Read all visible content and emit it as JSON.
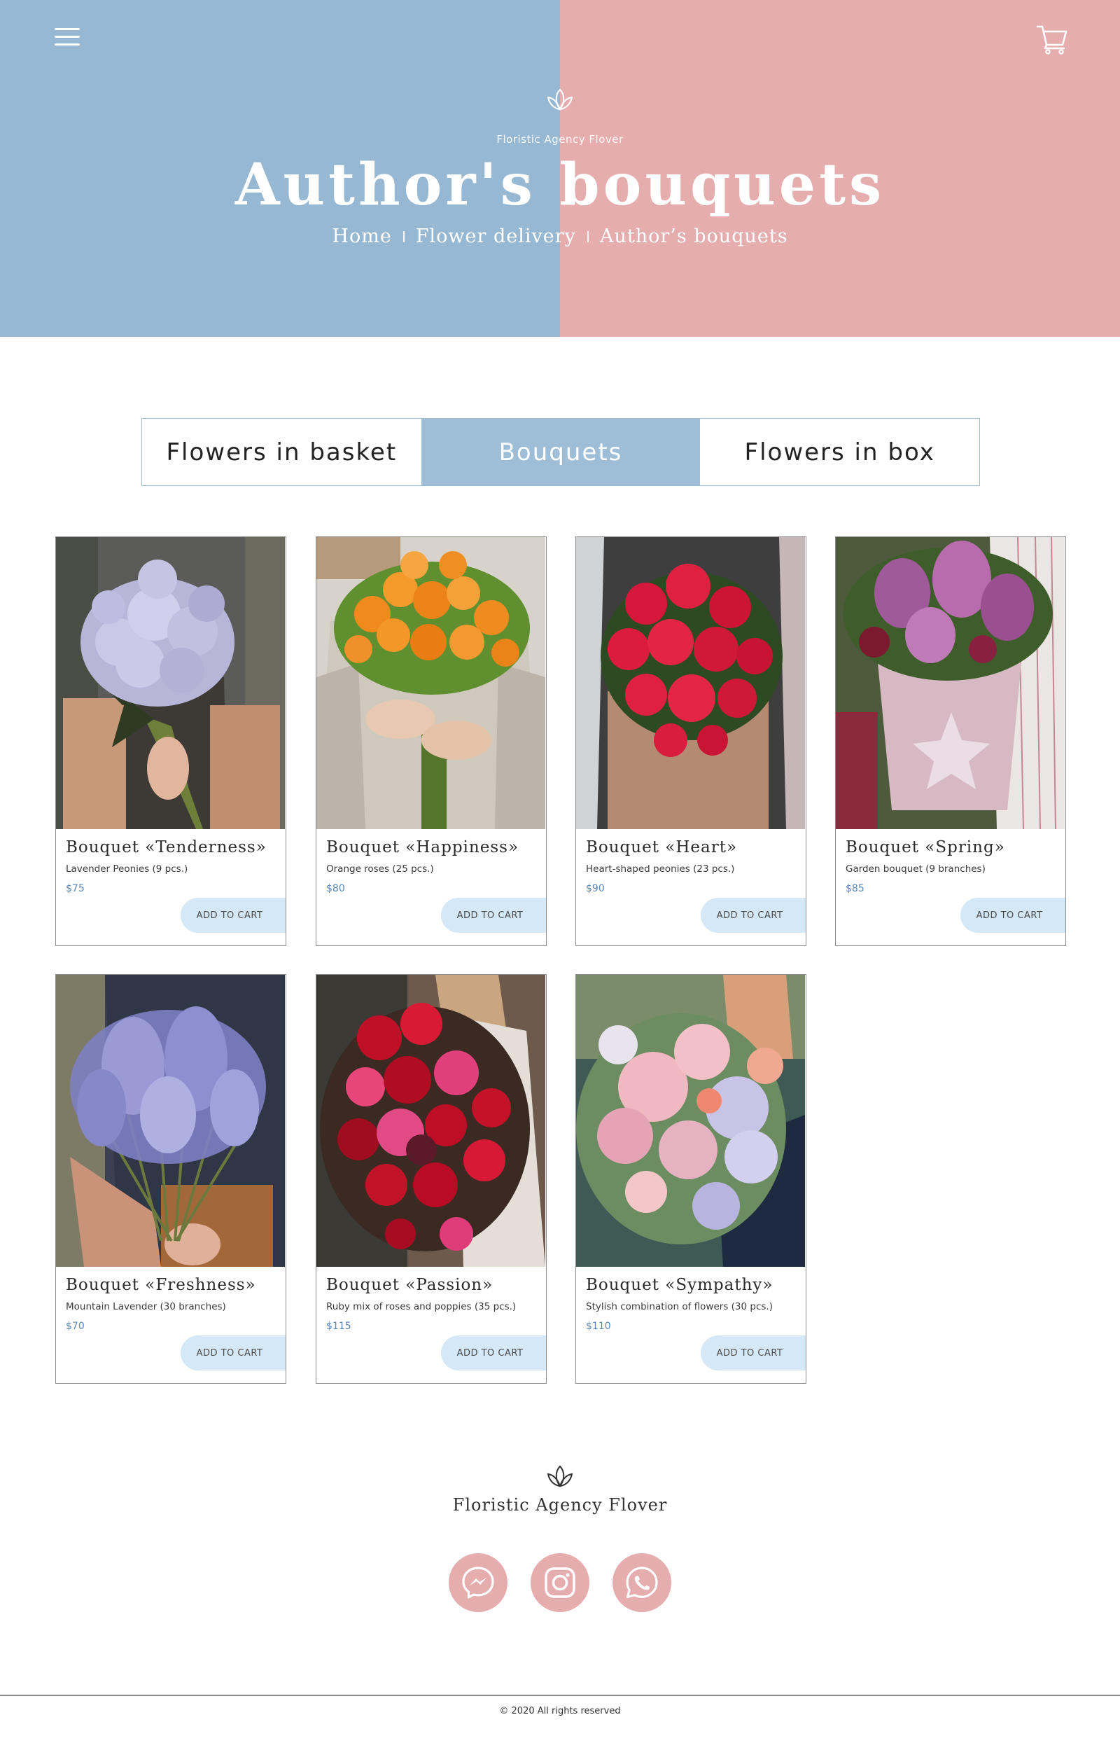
{
  "colors": {
    "hero_left": "#97b8d3",
    "hero_right": "#e6adae",
    "tab_active": "#9ebdd7",
    "button_bg": "#d5e8f7",
    "social_bg": "#e6adae",
    "price": "#5a86b4"
  },
  "header": {
    "menu_icon": "hamburger-menu-icon",
    "cart_icon": "shopping-cart-icon",
    "logo_icon": "lotus-icon",
    "tagline": "Floristic Agency Flover",
    "title": "Author's bouquets",
    "breadcrumb": [
      "Home",
      "Flower delivery",
      "Author’s bouquets"
    ]
  },
  "tabs": [
    {
      "label": "Flowers in basket",
      "active": false
    },
    {
      "label": "Bouquets",
      "active": true
    },
    {
      "label": "Flowers in box",
      "active": false
    }
  ],
  "products": [
    {
      "name": "Bouquet «Tenderness»",
      "desc": "Lavender Peonies (9 pcs.)",
      "price": "$75",
      "button": "ADD TO CART",
      "image": "lavender-peonies-bouquet"
    },
    {
      "name": "Bouquet «Happiness»",
      "desc": "Orange roses (25 pcs.)",
      "price": "$80",
      "button": "ADD TO CART",
      "image": "orange-roses-bouquet"
    },
    {
      "name": "Bouquet «Heart»",
      "desc": "Heart-shaped peonies (23 pcs.)",
      "price": "$90",
      "button": "ADD TO CART",
      "image": "red-peonies-bouquet"
    },
    {
      "name": "Bouquet «Spring»",
      "desc": "Garden bouquet (9 branches)",
      "price": "$85",
      "button": "ADD TO CART",
      "image": "garden-bouquet-in-basket"
    },
    {
      "name": "Bouquet «Freshness»",
      "desc": "Mountain Lavender (30 branches)",
      "price": "$70",
      "button": "ADD TO CART",
      "image": "lavender-branches-bouquet"
    },
    {
      "name": "Bouquet «Passion»",
      "desc": "Ruby mix of roses and poppies (35 pcs.)",
      "price": "$115",
      "button": "ADD TO CART",
      "image": "ruby-roses-poppies-bouquet"
    },
    {
      "name": "Bouquet «Sympathy»",
      "desc": "Stylish combination of flowers (30 pcs.)",
      "price": "$110",
      "button": "ADD TO CART",
      "image": "pastel-mixed-bouquet"
    }
  ],
  "footer": {
    "logo_icon": "lotus-icon",
    "brand": "Floristic Agency Flover",
    "socials": [
      {
        "name": "messenger",
        "icon": "messenger-icon"
      },
      {
        "name": "instagram",
        "icon": "instagram-icon"
      },
      {
        "name": "whatsapp",
        "icon": "whatsapp-icon"
      }
    ],
    "copyright": "© 2020 All rights reserved"
  }
}
